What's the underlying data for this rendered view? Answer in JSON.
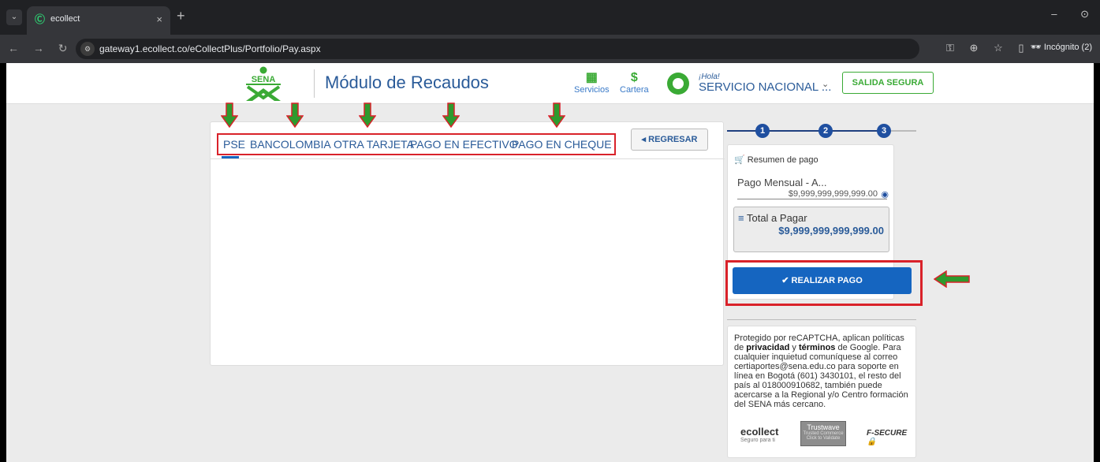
{
  "browser": {
    "tab_title": "ecollect",
    "tab_close": "×",
    "new_tab": "+",
    "url": "gateway1.ecollect.co/eCollectPlus/Portfolio/Pay.aspx",
    "incognito_label": "Incógnito (2)",
    "window_minimize": "–",
    "window_restore": "⊙"
  },
  "header": {
    "logo_text": "SENA",
    "title": "Módulo de Recaudos",
    "services_label": "Servicios",
    "wallet_label": "Cartera",
    "wallet_icon": "$",
    "greeting": "¡Hola!",
    "user_name": "SERVICIO NACIONAL ...",
    "logout_label": "SALIDA SEGURA"
  },
  "payment": {
    "methods": [
      "PSE",
      "BANCOLOMBIA",
      "OTRA TARJETA",
      "PAGO EN EFECTIVO",
      "PAGO EN CHEQUE"
    ],
    "back_label": "REGRESAR"
  },
  "stepper": {
    "steps": [
      "1",
      "2",
      "3"
    ]
  },
  "summary": {
    "heading": "Resumen de pago",
    "item_name": "Pago Mensual - A...",
    "item_amount": "$9,999,999,999,999.00",
    "total_label": "Total a Pagar",
    "total_value": "$9,999,999,999,999.00",
    "pay_label": "REALIZAR PAGO"
  },
  "info": {
    "text_1": "Protegido por reCAPTCHA, aplican políticas de ",
    "privacy": "privacidad",
    "text_2": " y ",
    "terms": "términos",
    "text_3": " de Google. Para cualquier inquietud comuníquese al correo certiaportes@sena.edu.co para soporte en línea en Bogotá (601) 3430101, el resto del país al 018000910682, también puede acercarse a la Regional y/o Centro formación del SENA más cercano.",
    "badge_ecollect": "ecollect",
    "badge_ecollect_sub": "Seguro para ti",
    "badge_trust": "Trustwave",
    "badge_trust_sub": "Trusted Commerce",
    "badge_trust_click": "Click to Validate",
    "badge_secure": "F-SECURE"
  },
  "colors": {
    "brand_green": "#3aaa35",
    "brand_blue": "#2a5b99",
    "pay_button": "#1565c0",
    "highlight_red": "#d9222a",
    "arrow_green": "#2e9a2e"
  }
}
